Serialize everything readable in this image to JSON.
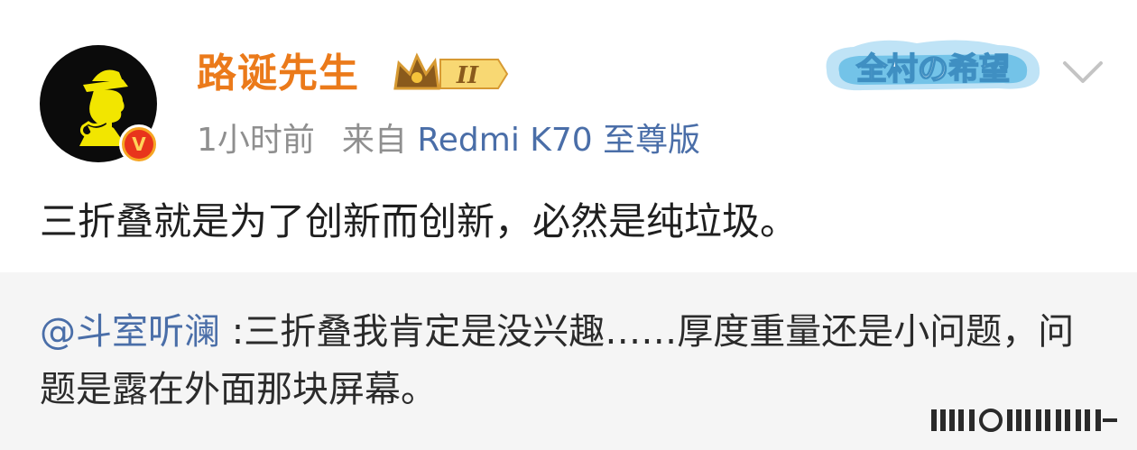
{
  "post": {
    "username": "路诞先生",
    "crown_level": "II",
    "timestamp": "1小时前",
    "source_prefix": "来自",
    "device": "Redmi K70 至尊版",
    "topic_badge_text": "全村の希望",
    "text": "三折叠就是为了创新而创新，必然是纯垃圾。"
  },
  "quote": {
    "mention": "@斗室听澜",
    "separator": " :",
    "text": "三折叠我肯定是没兴趣……厚度重量还是小问题，问题是露在外面那块屏幕。"
  },
  "colors": {
    "username": "#eb7a1a",
    "link_blue": "#4a6ea8",
    "meta_gray": "#8f8f8f",
    "quote_bg": "#f5f5f5"
  },
  "icons": {
    "avatar": "detective-avatar-icon",
    "verified": "verified-v-icon",
    "crown": "crown-icon",
    "chevron": "chevron-down-icon"
  }
}
